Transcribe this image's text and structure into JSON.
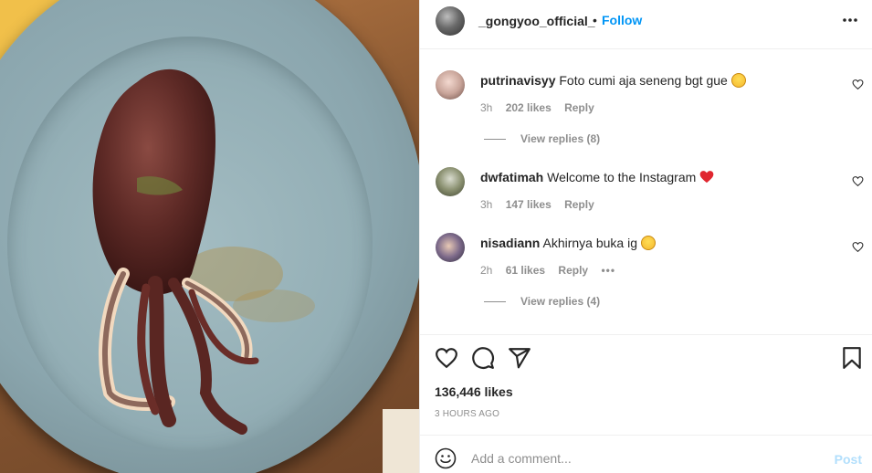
{
  "photo": {
    "alt_name": "grilled squid on a blue plate"
  },
  "header": {
    "username": "_gongyoo_official_",
    "separator": "•",
    "follow_label": "Follow"
  },
  "comments": [
    {
      "username": "putrinavisyy",
      "text": "Foto cumi aja seneng bgt gue",
      "emoji": "rolling-on-floor-laughing",
      "time": "3h",
      "likes": "202 likes",
      "reply_label": "Reply",
      "view_replies": "View replies (8)"
    },
    {
      "username": "dwfatimah",
      "text": "Welcome to the Instagram",
      "emoji": "red-heart",
      "time": "3h",
      "likes": "147 likes",
      "reply_label": "Reply"
    },
    {
      "username": "nisadiann",
      "text": "Akhirnya buka ig",
      "emoji": "grinning-squinting-face",
      "time": "2h",
      "likes": "61 likes",
      "reply_label": "Reply",
      "more": "•••",
      "view_replies": "View replies (4)"
    }
  ],
  "post": {
    "likes": "136,446 likes",
    "time_ago": "3 HOURS AGO"
  },
  "add_comment": {
    "placeholder": "Add a comment...",
    "post_label": "Post"
  },
  "colors": {
    "accent": "#0095f6",
    "post_disabled": "#b2dffc",
    "muted": "#8e8e8e",
    "text": "#262626",
    "heart": "#ed4956"
  }
}
